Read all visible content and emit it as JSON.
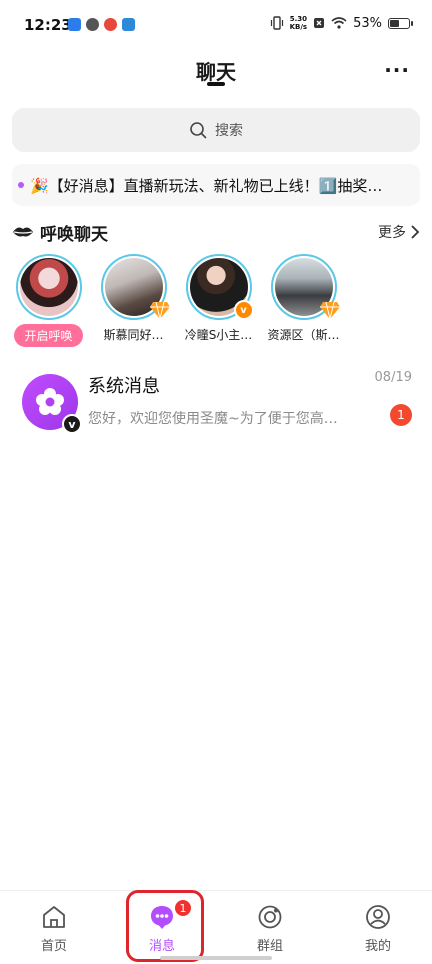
{
  "status_bar": {
    "time": "12:23",
    "net_speed_value": "5.30",
    "net_speed_unit": "KB/s",
    "battery_percent": "53%",
    "battery_level": 0.53
  },
  "header": {
    "title": "聊天",
    "more": "···"
  },
  "search": {
    "placeholder": "搜索"
  },
  "notice": {
    "text": "🎉【好消息】直播新玩法、新礼物已上线！1️⃣抽奖…"
  },
  "call_section": {
    "title": "呼唤聊天",
    "more": "更多",
    "start_label": "开启呼唤",
    "items": [
      {
        "name": "斯慕同好…"
      },
      {
        "name": "冷瞳S小主…"
      },
      {
        "name": "资源区（斯…"
      }
    ]
  },
  "messages": [
    {
      "title": "系统消息",
      "date": "08/19",
      "preview": "您好，欢迎您使用圣魔~为了便于您高…",
      "unread": "1",
      "avatar_mark": "v"
    }
  ],
  "tabbar": {
    "items": [
      {
        "label": "首页",
        "icon": "home-icon"
      },
      {
        "label": "消息",
        "icon": "chat-bubble-icon",
        "badge": "1"
      },
      {
        "label": "群组",
        "icon": "group-icon"
      },
      {
        "label": "我的",
        "icon": "profile-icon"
      }
    ]
  },
  "colors": {
    "accent": "#b34dff",
    "badge": "#f2302f",
    "pill": "#ff6f9a"
  }
}
